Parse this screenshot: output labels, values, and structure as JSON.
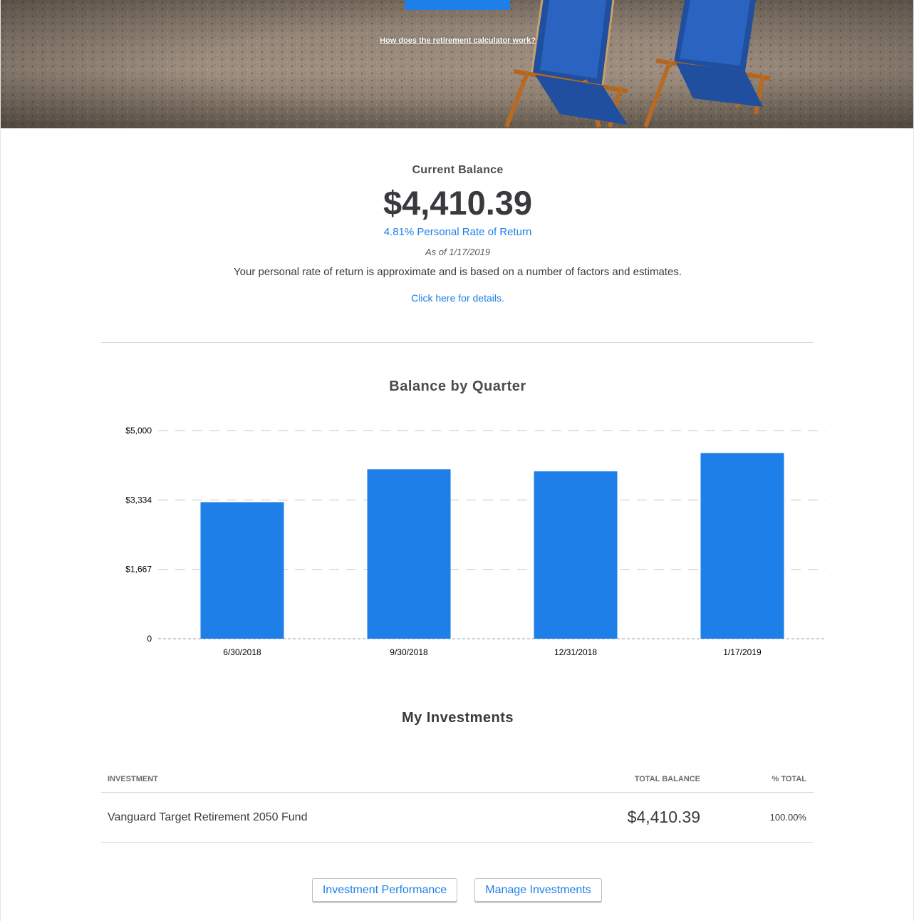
{
  "hero": {
    "link_text": "How does the retirement calculator work?"
  },
  "balance": {
    "label": "Current Balance",
    "value": "$4,410.39",
    "rate_of_return": "4.81% Personal Rate of Return",
    "as_of": "As of 1/17/2019",
    "disclaimer": "Your personal rate of return is approximate and is based on a number of factors and estimates.",
    "details_link": "Click here for details."
  },
  "chart_data": {
    "type": "bar",
    "title": "Balance by Quarter",
    "categories": [
      "6/30/2018",
      "9/30/2018",
      "12/31/2018",
      "1/17/2019"
    ],
    "values": [
      3280,
      4070,
      4020,
      4460
    ],
    "y_ticks": [
      "0",
      "$1,667",
      "$3,334",
      "$5,000"
    ],
    "ylim": [
      0,
      5000
    ],
    "xlabel": "",
    "ylabel": "",
    "grid": true,
    "bar_color": "#1e7fe8"
  },
  "investments": {
    "title": "My Investments",
    "columns": [
      "INVESTMENT",
      "TOTAL BALANCE",
      "% TOTAL"
    ],
    "rows": [
      {
        "name": "Vanguard Target Retirement 2050 Fund",
        "total": "$4,410.39",
        "percent": "100.00%"
      }
    ]
  },
  "buttons": {
    "performance": "Investment Performance",
    "manage": "Manage Investments"
  },
  "colors": {
    "accent": "#1e7fe8",
    "text": "#393a3d",
    "divider": "#d4d7dc"
  }
}
